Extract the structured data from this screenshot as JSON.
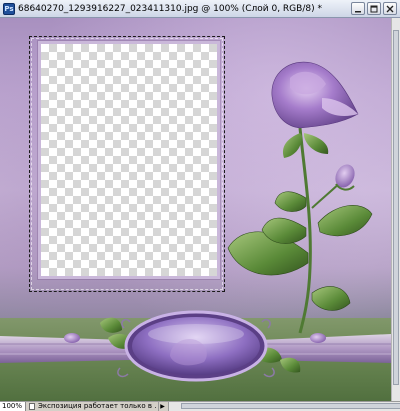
{
  "window": {
    "title": "68640270_1293916227_023411310.jpg @ 100% (Слой 0, RGB/8) *",
    "app_icon_letters": "Ps",
    "buttons": {
      "minimize": "minimize-icon",
      "maximize": "maximize-icon",
      "close": "close-icon"
    }
  },
  "canvas": {
    "zoom_percent": "100%",
    "layer": "Слой 0",
    "mode": "RGB/8"
  },
  "statusbar": {
    "zoom": "100%",
    "info": "Экспозиция работает только в ..."
  },
  "colors": {
    "lavender": "#bba4cf",
    "rose": "#9b72c2",
    "leaf": "#5f8b3c"
  }
}
